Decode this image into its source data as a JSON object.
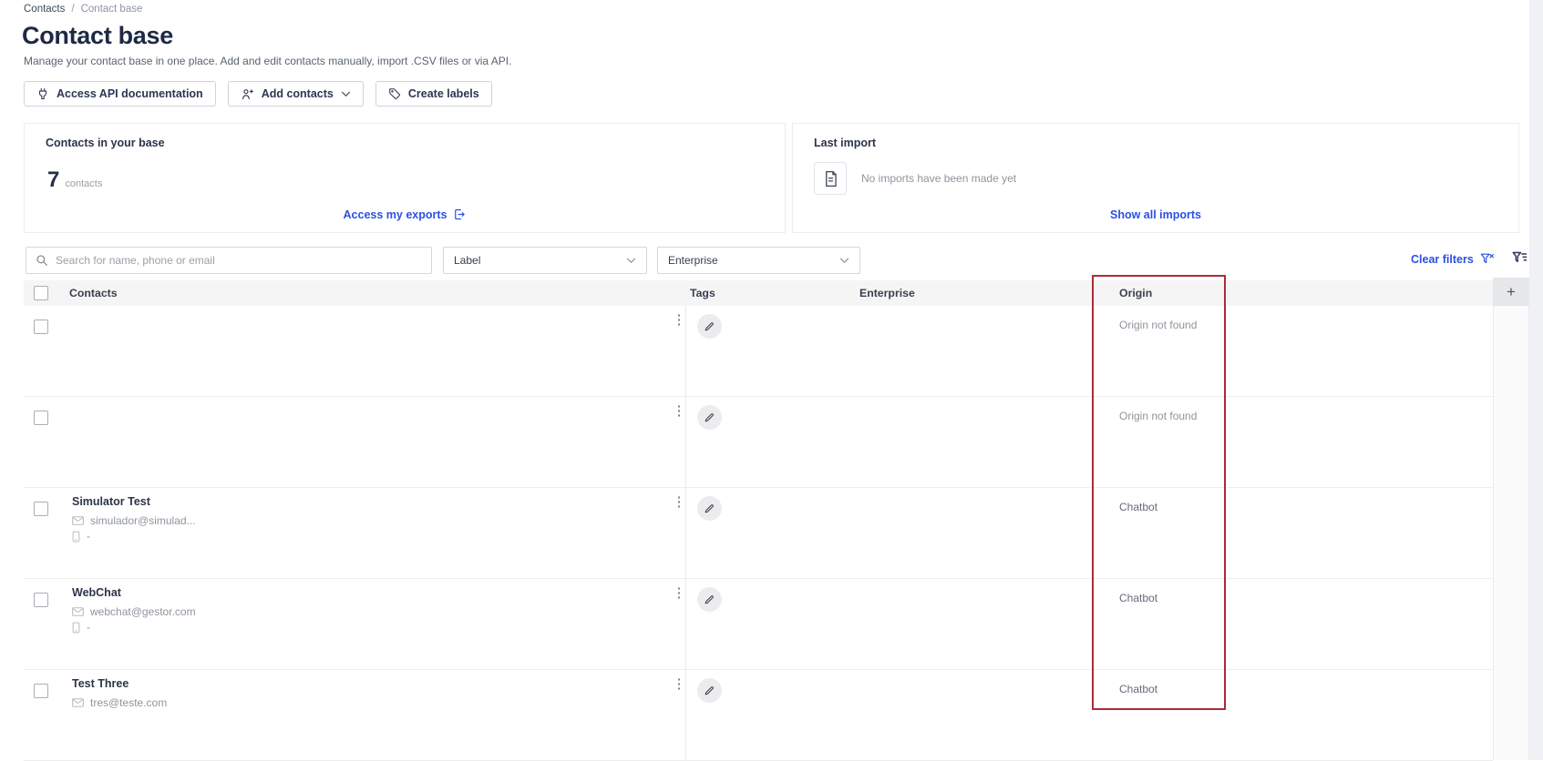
{
  "breadcrumb": {
    "root": "Contacts",
    "separator": "/",
    "current": "Contact base"
  },
  "header": {
    "title": "Contact base",
    "subtitle": "Manage your contact base in one place. Add and edit contacts manually, import .CSV files or via API."
  },
  "toolbar": {
    "api_button": "Access API documentation",
    "add_contacts_button": "Add contacts",
    "create_labels_button": "Create labels"
  },
  "cards": {
    "contacts": {
      "title": "Contacts in your base",
      "count": "7",
      "count_label": "contacts",
      "exports_link": "Access my exports"
    },
    "last_import": {
      "title": "Last import",
      "empty_message": "No imports have been made yet",
      "link": "Show all imports"
    }
  },
  "filters": {
    "search_placeholder": "Search for name, phone or email",
    "label_dropdown_value": "Label",
    "enterprise_dropdown_value": "Enterprise",
    "clear_filters_label": "Clear filters"
  },
  "table": {
    "columns": {
      "contacts": "Contacts",
      "tags": "Tags",
      "enterprise": "Enterprise",
      "origin": "Origin"
    },
    "add_column_label": "+",
    "rows": [
      {
        "name": "",
        "email": "",
        "phone": "",
        "enterprise": "",
        "origin": "Origin not found"
      },
      {
        "name": "",
        "email": "",
        "phone": "",
        "enterprise": "",
        "origin": "Origin not found"
      },
      {
        "name": "Simulator Test",
        "email": "simulador@simulad...",
        "phone": "-",
        "enterprise": "",
        "origin": "Chatbot"
      },
      {
        "name": "WebChat",
        "email": "webchat@gestor.com",
        "phone": "-",
        "enterprise": "",
        "origin": "Chatbot"
      },
      {
        "name": "Test Three",
        "email": "tres@teste.com",
        "phone": "",
        "enterprise": "",
        "origin": "Chatbot"
      }
    ]
  },
  "annotation": {
    "highlighted_column": "Origin",
    "highlight_color": "#b02a37"
  },
  "colors": {
    "link_blue": "#2b50e3",
    "header_bg": "#f5f5f6",
    "text_dark": "#2b3547",
    "text_muted": "#8f959e"
  }
}
